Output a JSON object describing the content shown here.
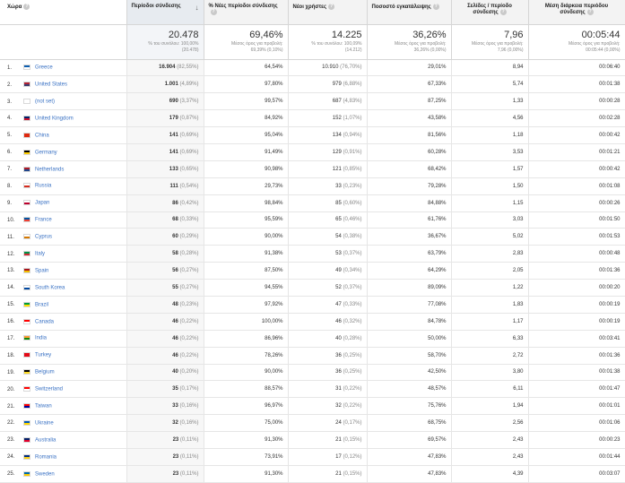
{
  "headers": {
    "country": "Χώρα",
    "sessions": "Περίοδοι σύνδεσης",
    "pct_new": "% Νέες περίοδοι σύνδεσης",
    "new_users": "Νέοι χρήστες",
    "bounce": "Ποσοστό εγκατάλειψης",
    "pages": "Σελίδες / περίοδο σύνδεσης",
    "duration": "Μέση διάρκεια περιόδου σύνδεσης"
  },
  "totals": {
    "sessions": {
      "value": "20.478",
      "sub1": "% του συνόλου: 100,00%",
      "sub2": "(20.478)"
    },
    "pct_new": {
      "value": "69,46%",
      "sub1": "Μέσος όρος για προβολή:",
      "sub2": "69,39% (0,10%)"
    },
    "new_users": {
      "value": "14.225",
      "sub1": "% του συνόλου: 100,09%",
      "sub2": "(14.212)"
    },
    "bounce": {
      "value": "36,26%",
      "sub1": "Μέσος όρος για προβολή:",
      "sub2": "36,26% (0,00%)"
    },
    "pages": {
      "value": "7,96",
      "sub1": "Μέσος όρος για προβολή:",
      "sub2": "7,96 (0,00%)"
    },
    "duration": {
      "value": "00:05:44",
      "sub1": "Μέσος όρος για προβολή:",
      "sub2": "00:05:44 (0,00%)"
    }
  },
  "rows": [
    {
      "idx": "1.",
      "country": "Greece",
      "flag_colors": [
        "#0d5eaf",
        "#ffffff"
      ],
      "sessions": "16.904",
      "sessions_pct": "(82,55%)",
      "pct_new": "64,54%",
      "new_users": "10.910",
      "new_users_pct": "(76,70%)",
      "bounce": "29,01%",
      "pages": "8,94",
      "duration": "00:06:40"
    },
    {
      "idx": "2.",
      "country": "United States",
      "flag_colors": [
        "#b22234",
        "#3c3b6e"
      ],
      "sessions": "1.001",
      "sessions_pct": "(4,89%)",
      "pct_new": "97,80%",
      "new_users": "979",
      "new_users_pct": "(6,88%)",
      "bounce": "67,33%",
      "pages": "5,74",
      "duration": "00:01:38"
    },
    {
      "idx": "3.",
      "country": "(not set)",
      "flag_colors": [
        "#ffffff",
        "#ffffff"
      ],
      "sessions": "690",
      "sessions_pct": "(3,37%)",
      "pct_new": "99,57%",
      "new_users": "687",
      "new_users_pct": "(4,83%)",
      "bounce": "87,25%",
      "pages": "1,33",
      "duration": "00:00:28"
    },
    {
      "idx": "4.",
      "country": "United Kingdom",
      "flag_colors": [
        "#012169",
        "#c8102e"
      ],
      "sessions": "179",
      "sessions_pct": "(0,87%)",
      "pct_new": "84,92%",
      "new_users": "152",
      "new_users_pct": "(1,07%)",
      "bounce": "43,58%",
      "pages": "4,56",
      "duration": "00:02:28"
    },
    {
      "idx": "5.",
      "country": "China",
      "flag_colors": [
        "#de2910",
        "#de2910"
      ],
      "sessions": "141",
      "sessions_pct": "(0,69%)",
      "pct_new": "95,04%",
      "new_users": "134",
      "new_users_pct": "(0,94%)",
      "bounce": "81,56%",
      "pages": "1,18",
      "duration": "00:00:42"
    },
    {
      "idx": "6.",
      "country": "Germany",
      "flag_colors": [
        "#000000",
        "#ffce00"
      ],
      "sessions": "141",
      "sessions_pct": "(0,69%)",
      "pct_new": "91,49%",
      "new_users": "129",
      "new_users_pct": "(0,91%)",
      "bounce": "60,28%",
      "pages": "3,53",
      "duration": "00:01:21"
    },
    {
      "idx": "7.",
      "country": "Netherlands",
      "flag_colors": [
        "#ae1c28",
        "#21468b"
      ],
      "sessions": "133",
      "sessions_pct": "(0,65%)",
      "pct_new": "90,98%",
      "new_users": "121",
      "new_users_pct": "(0,85%)",
      "bounce": "68,42%",
      "pages": "1,57",
      "duration": "00:00:42"
    },
    {
      "idx": "8.",
      "country": "Russia",
      "flag_colors": [
        "#ffffff",
        "#d52b1e"
      ],
      "sessions": "111",
      "sessions_pct": "(0,54%)",
      "pct_new": "29,73%",
      "new_users": "33",
      "new_users_pct": "(0,23%)",
      "bounce": "79,28%",
      "pages": "1,50",
      "duration": "00:01:08"
    },
    {
      "idx": "9.",
      "country": "Japan",
      "flag_colors": [
        "#ffffff",
        "#bc002d"
      ],
      "sessions": "86",
      "sessions_pct": "(0,42%)",
      "pct_new": "98,84%",
      "new_users": "85",
      "new_users_pct": "(0,60%)",
      "bounce": "84,88%",
      "pages": "1,15",
      "duration": "00:00:26"
    },
    {
      "idx": "10.",
      "country": "France",
      "flag_colors": [
        "#0055a4",
        "#ef4135"
      ],
      "sessions": "68",
      "sessions_pct": "(0,33%)",
      "pct_new": "95,59%",
      "new_users": "65",
      "new_users_pct": "(0,46%)",
      "bounce": "61,76%",
      "pages": "3,03",
      "duration": "00:01:50"
    },
    {
      "idx": "11.",
      "country": "Cyprus",
      "flag_colors": [
        "#ffffff",
        "#d57800"
      ],
      "sessions": "60",
      "sessions_pct": "(0,29%)",
      "pct_new": "90,00%",
      "new_users": "54",
      "new_users_pct": "(0,38%)",
      "bounce": "36,67%",
      "pages": "5,02",
      "duration": "00:01:53"
    },
    {
      "idx": "12.",
      "country": "Italy",
      "flag_colors": [
        "#009246",
        "#ce2b37"
      ],
      "sessions": "58",
      "sessions_pct": "(0,28%)",
      "pct_new": "91,38%",
      "new_users": "53",
      "new_users_pct": "(0,37%)",
      "bounce": "63,79%",
      "pages": "2,83",
      "duration": "00:00:48"
    },
    {
      "idx": "13.",
      "country": "Spain",
      "flag_colors": [
        "#aa151b",
        "#f1bf00"
      ],
      "sessions": "56",
      "sessions_pct": "(0,27%)",
      "pct_new": "87,50%",
      "new_users": "49",
      "new_users_pct": "(0,34%)",
      "bounce": "64,29%",
      "pages": "2,05",
      "duration": "00:01:36"
    },
    {
      "idx": "14.",
      "country": "South Korea",
      "flag_colors": [
        "#ffffff",
        "#0047a0"
      ],
      "sessions": "55",
      "sessions_pct": "(0,27%)",
      "pct_new": "94,55%",
      "new_users": "52",
      "new_users_pct": "(0,37%)",
      "bounce": "89,09%",
      "pages": "1,22",
      "duration": "00:00:20"
    },
    {
      "idx": "15.",
      "country": "Brazil",
      "flag_colors": [
        "#009c3b",
        "#ffdf00"
      ],
      "sessions": "48",
      "sessions_pct": "(0,23%)",
      "pct_new": "97,92%",
      "new_users": "47",
      "new_users_pct": "(0,33%)",
      "bounce": "77,08%",
      "pages": "1,83",
      "duration": "00:00:19"
    },
    {
      "idx": "16.",
      "country": "Canada",
      "flag_colors": [
        "#ff0000",
        "#ffffff"
      ],
      "sessions": "46",
      "sessions_pct": "(0,22%)",
      "pct_new": "100,00%",
      "new_users": "46",
      "new_users_pct": "(0,32%)",
      "bounce": "84,78%",
      "pages": "1,17",
      "duration": "00:00:19"
    },
    {
      "idx": "17.",
      "country": "India",
      "flag_colors": [
        "#ff9933",
        "#138808"
      ],
      "sessions": "46",
      "sessions_pct": "(0,22%)",
      "pct_new": "86,96%",
      "new_users": "40",
      "new_users_pct": "(0,28%)",
      "bounce": "50,00%",
      "pages": "6,33",
      "duration": "00:03:41"
    },
    {
      "idx": "18.",
      "country": "Turkey",
      "flag_colors": [
        "#e30a17",
        "#e30a17"
      ],
      "sessions": "46",
      "sessions_pct": "(0,22%)",
      "pct_new": "78,26%",
      "new_users": "36",
      "new_users_pct": "(0,25%)",
      "bounce": "58,70%",
      "pages": "2,72",
      "duration": "00:01:36"
    },
    {
      "idx": "19.",
      "country": "Belgium",
      "flag_colors": [
        "#000000",
        "#fdda24"
      ],
      "sessions": "40",
      "sessions_pct": "(0,20%)",
      "pct_new": "90,00%",
      "new_users": "36",
      "new_users_pct": "(0,25%)",
      "bounce": "42,50%",
      "pages": "3,80",
      "duration": "00:01:38"
    },
    {
      "idx": "20.",
      "country": "Switzerland",
      "flag_colors": [
        "#ff0000",
        "#ffffff"
      ],
      "sessions": "35",
      "sessions_pct": "(0,17%)",
      "pct_new": "88,57%",
      "new_users": "31",
      "new_users_pct": "(0,22%)",
      "bounce": "48,57%",
      "pages": "6,11",
      "duration": "00:01:47"
    },
    {
      "idx": "21.",
      "country": "Taiwan",
      "flag_colors": [
        "#fe0000",
        "#000095"
      ],
      "sessions": "33",
      "sessions_pct": "(0,16%)",
      "pct_new": "96,97%",
      "new_users": "32",
      "new_users_pct": "(0,22%)",
      "bounce": "75,76%",
      "pages": "1,94",
      "duration": "00:01:01"
    },
    {
      "idx": "22.",
      "country": "Ukraine",
      "flag_colors": [
        "#0057b7",
        "#ffd700"
      ],
      "sessions": "32",
      "sessions_pct": "(0,16%)",
      "pct_new": "75,00%",
      "new_users": "24",
      "new_users_pct": "(0,17%)",
      "bounce": "68,75%",
      "pages": "2,56",
      "duration": "00:01:06"
    },
    {
      "idx": "23.",
      "country": "Australia",
      "flag_colors": [
        "#012169",
        "#e4002b"
      ],
      "sessions": "23",
      "sessions_pct": "(0,11%)",
      "pct_new": "91,30%",
      "new_users": "21",
      "new_users_pct": "(0,15%)",
      "bounce": "69,57%",
      "pages": "2,43",
      "duration": "00:00:23"
    },
    {
      "idx": "24.",
      "country": "Romania",
      "flag_colors": [
        "#002b7f",
        "#fcd116"
      ],
      "sessions": "23",
      "sessions_pct": "(0,11%)",
      "pct_new": "73,91%",
      "new_users": "17",
      "new_users_pct": "(0,12%)",
      "bounce": "47,83%",
      "pages": "2,43",
      "duration": "00:01:44"
    },
    {
      "idx": "25.",
      "country": "Sweden",
      "flag_colors": [
        "#006aa7",
        "#fecc00"
      ],
      "sessions": "23",
      "sessions_pct": "(0,11%)",
      "pct_new": "91,30%",
      "new_users": "21",
      "new_users_pct": "(0,15%)",
      "bounce": "47,83%",
      "pages": "4,39",
      "duration": "00:03:07"
    }
  ]
}
